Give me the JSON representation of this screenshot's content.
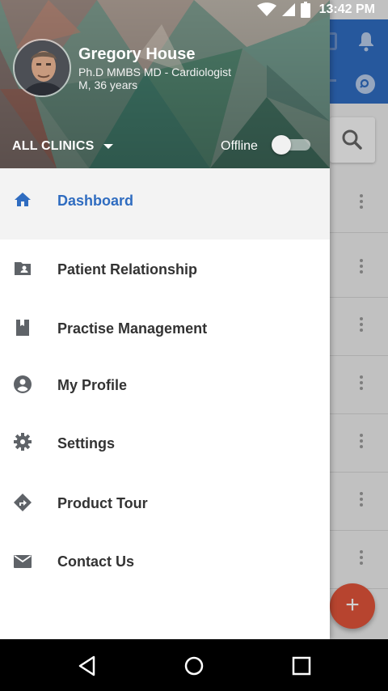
{
  "status_bar": {
    "time": "13:42 PM",
    "icons": [
      "wifi-icon",
      "signal-icon",
      "battery-icon"
    ]
  },
  "profile": {
    "name": "Gregory House",
    "degree": "Ph.D MMBS MD - Cardiologist",
    "age_gender": "M, 36 years",
    "avatar": "avatar-photo"
  },
  "clinic_selector": {
    "label": "ALL CLINICS",
    "icon": "dropdown-caret-icon"
  },
  "offline_toggle": {
    "label": "Offline",
    "on": false
  },
  "menu": {
    "items": [
      {
        "label": "Dashboard",
        "icon": "home-icon",
        "active": true
      },
      {
        "label": "Patient Relationship",
        "icon": "folder-account-icon",
        "active": false
      },
      {
        "label": "Practise Management",
        "icon": "bookmark-book-icon",
        "active": false
      },
      {
        "label": "My Profile",
        "icon": "account-circle-icon",
        "active": false
      },
      {
        "label": "Settings",
        "icon": "gear-icon",
        "active": false
      },
      {
        "label": "Product Tour",
        "icon": "directions-icon",
        "active": false
      },
      {
        "label": "Contact Us",
        "icon": "mail-icon",
        "active": false
      }
    ]
  },
  "background_app": {
    "fab_symbol": "+",
    "icons": [
      "calendar-icon",
      "bell-icon",
      "search-icon",
      "more-vert-icon"
    ]
  },
  "nav_bar": {
    "icons": [
      "back-icon",
      "home-circle-icon",
      "recents-icon"
    ]
  },
  "colors": {
    "primary": "#2f6cc0",
    "accent_fab": "#e0533a",
    "active_row": "#f3f3f3",
    "text": "#333333"
  }
}
